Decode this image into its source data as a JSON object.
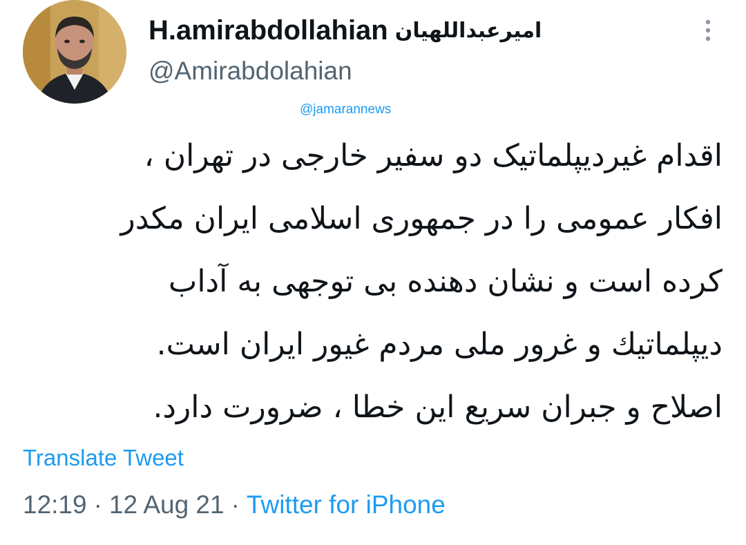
{
  "author": {
    "display_name_latin": "H.amirabdollahian",
    "display_name_persian": "امیرعبداللهیان",
    "handle": "@Amirabdolahian",
    "avatar_icon": "profile-photo"
  },
  "menu": {
    "more_icon": "vertical-ellipsis-icon"
  },
  "watermark": "@jamarannews",
  "tweet": {
    "lines": [
      "اقدام غیردیپلماتیک دو سفیر خارجی در تهران ،",
      "افکار عمومی را در جمهوری اسلامی ایران مکدر",
      "کرده است و نشان دهنده بی توجهی به آداب",
      "دیپلماتيك  و غرور ملی مردم غیور ایران است.",
      "اصلاح و جبران سریع این خطا ، ضرورت دارد."
    ]
  },
  "translate_label": "Translate Tweet",
  "meta": {
    "time": "12:19",
    "separator": "·",
    "date": "12 Aug 21",
    "source": "Twitter for iPhone"
  },
  "colors": {
    "text": "#0f1419",
    "secondary": "#536471",
    "link": "#1d9bf0",
    "background": "#ffffff"
  }
}
